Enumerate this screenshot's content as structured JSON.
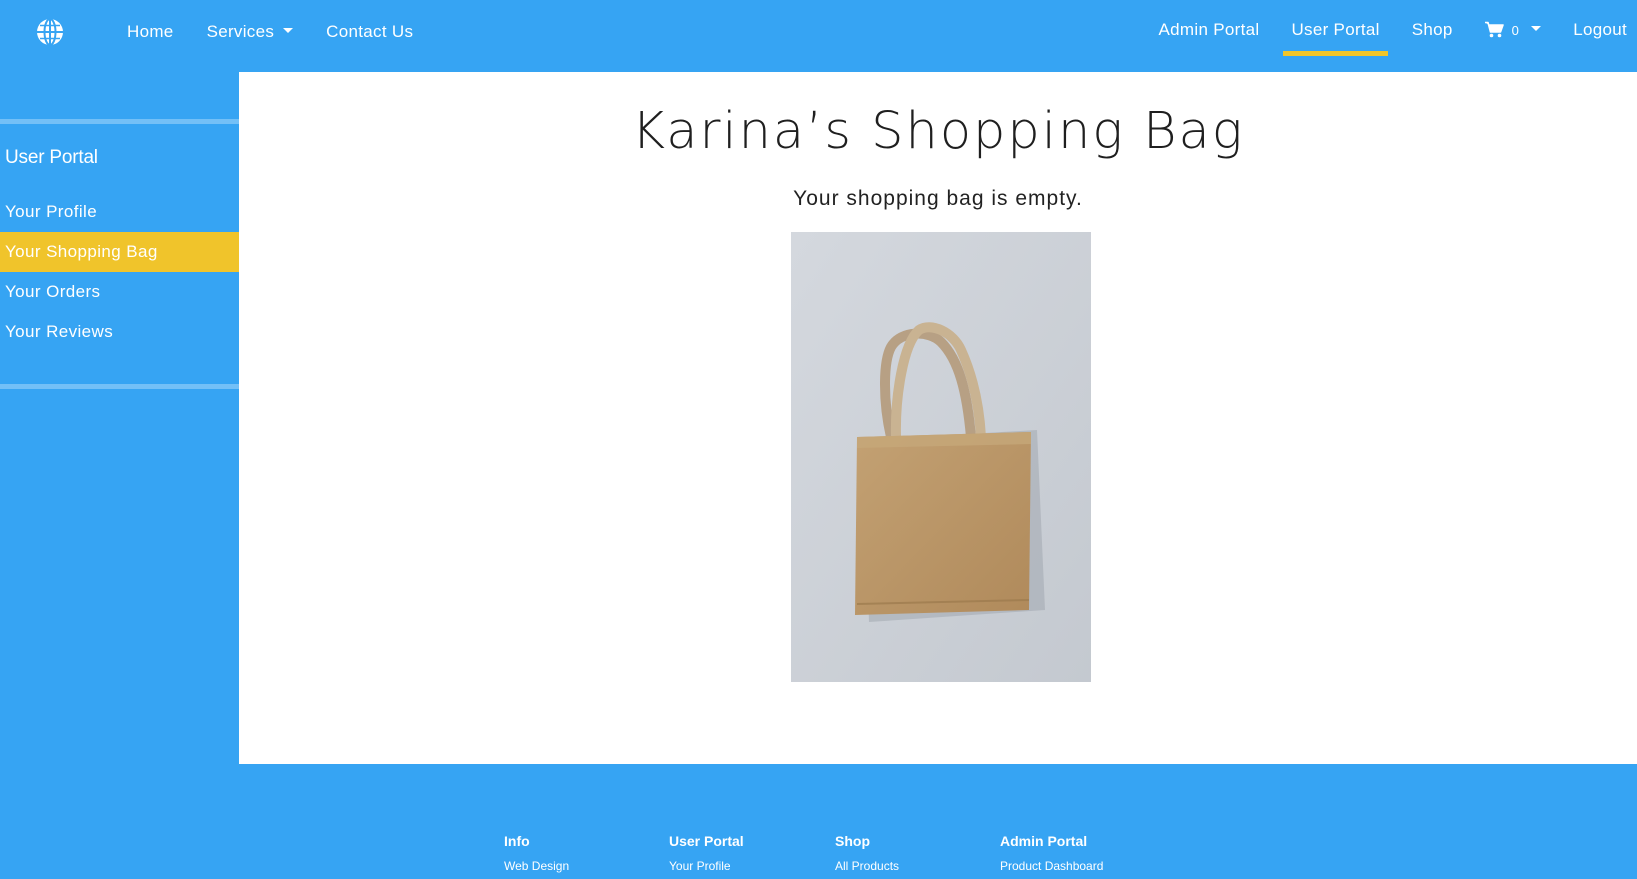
{
  "nav": {
    "logo_icon": "globe-icon",
    "left": [
      {
        "label": "Home"
      },
      {
        "label": "Services"
      },
      {
        "label": "Contact Us"
      }
    ],
    "right": {
      "admin_portal": "Admin Portal",
      "user_portal": "User Portal",
      "shop": "Shop",
      "cart_count": "0",
      "logout": "Logout"
    },
    "active_indicator_color": "#f1c52a"
  },
  "sidebar": {
    "title": "User Portal",
    "items": [
      {
        "label": "Your Profile"
      },
      {
        "label": "Your Shopping Bag"
      },
      {
        "label": "Your Orders"
      },
      {
        "label": "Your Reviews"
      }
    ],
    "active_index": 1,
    "active_color": "#f0c42b"
  },
  "main": {
    "title": "Karina’s Shopping Bag",
    "empty_message": "Your shopping bag is empty.",
    "image_icon": "shopping-bag-image"
  },
  "footer": {
    "columns": [
      {
        "heading": "Info",
        "link": "Web Design"
      },
      {
        "heading": "User Portal",
        "link": "Your Profile"
      },
      {
        "heading": "Shop",
        "link": "All Products"
      },
      {
        "heading": "Admin Portal",
        "link": "Product Dashboard"
      }
    ]
  },
  "colors": {
    "primary_blue": "#36a4f3",
    "accent_yellow": "#f0c42b"
  }
}
